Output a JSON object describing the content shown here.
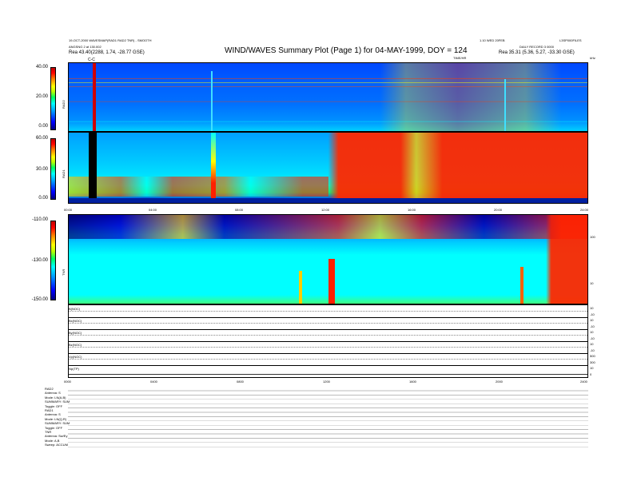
{
  "header": {
    "top_left_line1": "19-OCT-2000 WAVESMAP(RAD1 RAD2 TNR)  -  SMOOTH",
    "top_left_line2": "ANGSNG 2 at 130.002",
    "top_left_line3": "Rea   43.40(2288, 1.74, -28.77 GSE)",
    "title": "WIND/WAVES Summary Plot (Page 1) for 04-MAY-1999, DOY = 124",
    "top_right_line1": "1.10 WED 20FEB",
    "top_right_code": "L3SP000FILES",
    "top_right_line2": "DAILY RECORD 3 0000",
    "top_right_line3": "Rea   35.31 (5.36, 5.27, -33.30 GSE)",
    "freq_unit": "kHz",
    "time_unit": "TIME/HR"
  },
  "marker": {
    "label": "C-C"
  },
  "panels": {
    "rad2": {
      "name": "RAD2",
      "ticks": [
        "40.00",
        "20.00",
        "0.00"
      ]
    },
    "rad1": {
      "name": "RAD1",
      "ticks": [
        "60.00",
        "30.00",
        "0.00"
      ]
    },
    "tnr": {
      "name": "TNR",
      "ticks": [
        "-110.00",
        "-130.00",
        "-150.00"
      ],
      "right_ticks": [
        "100",
        "10"
      ]
    }
  },
  "time_axis_1": [
    "00:00",
    "04:00",
    "08:00",
    "12:00",
    "16:00",
    "20:00",
    "24:00"
  ],
  "time_axis_2": [
    "0000",
    "0400",
    "0800",
    "1200",
    "1600",
    "2000",
    "2400"
  ],
  "mag_rows": [
    {
      "label": "B(NOC)",
      "scale_top": "10",
      "scale_bot": "-10"
    },
    {
      "label": "Bx(NOC)",
      "scale_top": "10",
      "scale_bot": "-10"
    },
    {
      "label": "By(NOC)",
      "scale_top": "10",
      "scale_bot": "-10"
    },
    {
      "label": "Bz(NOC)",
      "scale_top": "10",
      "scale_bot": "-10"
    },
    {
      "label": "Vp(NOC)",
      "scale_top": "500",
      "scale_bot": "300"
    },
    {
      "label": "Np(TP)",
      "scale_top": "10",
      "scale_bot": "0"
    }
  ],
  "info_block": [
    "RAD2",
    "Antenna:   S",
    "Mode:   LN(A,B)",
    "SUMMARY: SUM",
    "Toggle:   OFF",
    "RAD1",
    "Antenna:   S",
    "Mode:   LN(Q,R)",
    "SUMMARY: SUM",
    "Toggle:   OFF",
    "TNR",
    "Antenna:   Sw/Ey",
    "Mode:   A,B",
    "Sweep:   ACCUM"
  ],
  "chart_data": {
    "type": "heatmap",
    "title": "WIND/WAVES Summary Plot (Page 1) for 04-MAY-1999, DOY = 124",
    "x_range_hours": [
      0,
      24
    ],
    "x_ticks": [
      "00:00",
      "04:00",
      "08:00",
      "12:00",
      "16:00",
      "20:00",
      "24:00"
    ],
    "panels": [
      {
        "name": "RAD2",
        "y_ticks": [
          40.0,
          20.0,
          0.0
        ]
      },
      {
        "name": "RAD1",
        "y_ticks": [
          60.0,
          30.0,
          0.0
        ]
      },
      {
        "name": "TNR",
        "y_ticks": [
          -110.0,
          -130.0,
          -150.0
        ],
        "right_ticks": [
          100,
          10
        ]
      }
    ],
    "colors": {
      "low": "#0000ff",
      "mid": "#00ffff",
      "high": "#ff0000"
    }
  }
}
